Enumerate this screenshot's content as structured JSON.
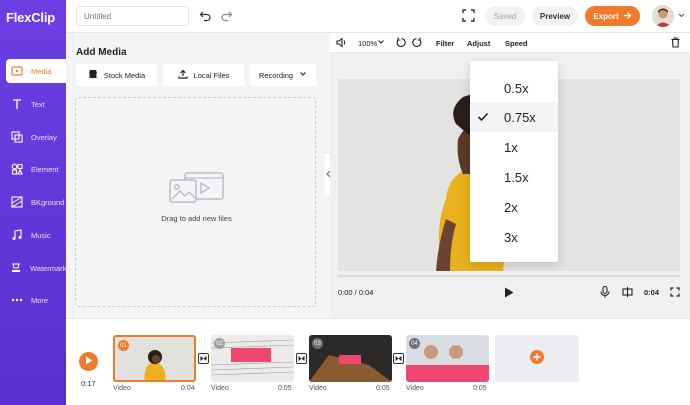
{
  "app": {
    "name": "FlexClip"
  },
  "topbar": {
    "title_placeholder": "Untitled",
    "saved_label": "Saved",
    "preview_label": "Preview",
    "export_label": "Export"
  },
  "sidebar": {
    "items": [
      {
        "label": "Media",
        "icon": "media-icon",
        "active": true
      },
      {
        "label": "Text",
        "icon": "text-icon"
      },
      {
        "label": "Overlay",
        "icon": "overlay-icon"
      },
      {
        "label": "Element",
        "icon": "element-icon"
      },
      {
        "label": "BKground",
        "icon": "background-icon"
      },
      {
        "label": "Music",
        "icon": "music-icon"
      },
      {
        "label": "Watermark",
        "icon": "watermark-icon"
      },
      {
        "label": "More",
        "icon": "more-icon"
      }
    ]
  },
  "media_panel": {
    "title": "Add Media",
    "buttons": {
      "stock": "Stock Media",
      "local": "Local Files",
      "recording": "Recording"
    },
    "drop_text": "Drag to add new files"
  },
  "editor": {
    "zoom": "100%",
    "filter_label": "Filter",
    "adjust_label": "Adjust",
    "speed_label": "Speed",
    "time_current": "0:00 / 0:04",
    "time_end": "0:04"
  },
  "speed_menu": {
    "options": [
      "0.5x",
      "0.75x",
      "1x",
      "1.5x",
      "2x",
      "3x"
    ],
    "selected": "0.75x"
  },
  "timeline": {
    "playhead_time": "0:17",
    "clips": [
      {
        "num": "01",
        "label": "Video",
        "duration": "0:04"
      },
      {
        "num": "02",
        "label": "Video",
        "duration": "0:05"
      },
      {
        "num": "03",
        "label": "Video",
        "duration": "0:05"
      },
      {
        "num": "04",
        "label": "Video",
        "duration": "0:05"
      }
    ]
  },
  "colors": {
    "accent": "#f17a2a",
    "sidebar": "#6d3fe3"
  }
}
